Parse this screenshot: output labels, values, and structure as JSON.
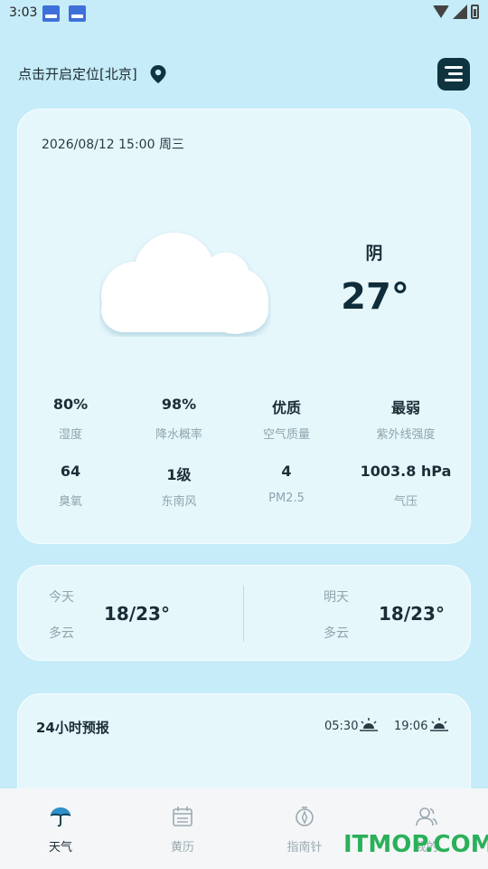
{
  "status_bar": {
    "time": "3:03"
  },
  "header": {
    "location": "点击开启定位[北京]"
  },
  "weather": {
    "datetime": "2026/08/12 15:00 周三",
    "condition": "阴",
    "temperature": "27°",
    "stats": [
      {
        "value": "80%",
        "label": "湿度"
      },
      {
        "value": "98%",
        "label": "降水概率"
      },
      {
        "value": "优质",
        "label": "空气质量"
      },
      {
        "value": "最弱",
        "label": "紫外线强度"
      },
      {
        "value": "64",
        "label": "臭氧"
      },
      {
        "value": "1级",
        "label": "东南风"
      },
      {
        "value": "4",
        "label": "PM2.5"
      },
      {
        "value": "1003.8 hPa",
        "label": "气压"
      }
    ]
  },
  "days": {
    "today": {
      "label": "今天",
      "condition": "多云",
      "temp": "18/23°"
    },
    "tomorrow": {
      "label": "明天",
      "condition": "多云",
      "temp": "18/23°"
    }
  },
  "forecast": {
    "title": "24小时预报",
    "sunrise": "05:30",
    "sunset": "19:06"
  },
  "nav": [
    {
      "label": "天气",
      "icon": "umbrella-icon",
      "active": true
    },
    {
      "label": "黄历",
      "icon": "calendar-icon",
      "active": false
    },
    {
      "label": "指南针",
      "icon": "compass-icon",
      "active": false
    },
    {
      "label": "我的",
      "icon": "user-icon",
      "active": false
    }
  ],
  "watermark": "ITMOP.COM"
}
